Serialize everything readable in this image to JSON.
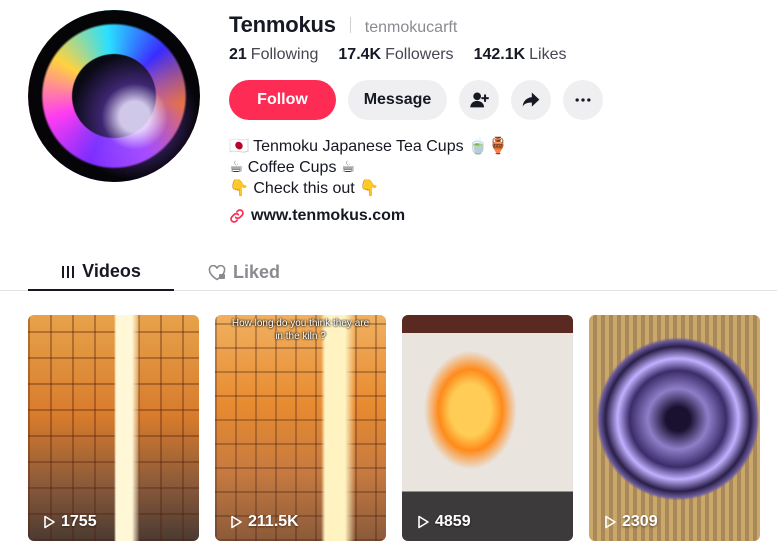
{
  "profile": {
    "username": "Tenmokus",
    "handle": "tenmokucarft",
    "stats": [
      {
        "count": "21",
        "label": "Following"
      },
      {
        "count": "17.4K",
        "label": "Followers"
      },
      {
        "count": "142.1K",
        "label": "Likes"
      }
    ],
    "follow_label": "Follow",
    "message_label": "Message",
    "bio": [
      "🇯🇵 Tenmoku Japanese Tea Cups 🍵🏺",
      "☕ Coffee Cups ☕",
      "👇 Check this out 👇"
    ],
    "link": "www.tenmokus.com"
  },
  "tabs": [
    {
      "label": "Videos",
      "icon": "grid-icon",
      "active": true
    },
    {
      "label": "Liked",
      "icon": "heart-lock-icon",
      "active": false
    }
  ],
  "videos": [
    {
      "views": "1755",
      "caption": ""
    },
    {
      "views": "211.5K",
      "caption": "How long do you think they are in the kiln ?"
    },
    {
      "views": "4859",
      "caption": ""
    },
    {
      "views": "2309",
      "caption": ""
    }
  ],
  "colors": {
    "accent": "#fe2c55",
    "button_bg": "#efeff1",
    "text": "#161823",
    "muted": "#8a8b91"
  }
}
